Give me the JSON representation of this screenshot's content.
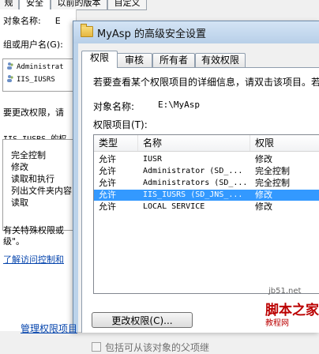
{
  "background": {
    "tabs": [
      "规",
      "安全",
      "以前的版本",
      "自定义"
    ],
    "object_label": "对象名称:",
    "object_value_fragment": "E",
    "group_label": "组或用户名(G):",
    "users": [
      "Administrat",
      "IIS_IUSRS"
    ],
    "change_text": "要更改权限，请",
    "perm_title": "IIS_IUSRS 的权",
    "permissions": [
      "完全控制",
      "修改",
      "读取和执行",
      "列出文件夹内容",
      "读取"
    ],
    "special_text_1": "有关特殊权限或",
    "special_text_2": "级\"。",
    "link_text": "了解访问控制和"
  },
  "dialog": {
    "title": "MyAsp 的高级安全设置",
    "tabs": [
      "权限",
      "审核",
      "所有者",
      "有效权限"
    ],
    "description": "若要查看某个权限项目的详细信息，请双击该项目。若",
    "object_label": "对象名称:",
    "object_value": "E:\\MyAsp",
    "entries_label": "权限项目(T):",
    "columns": [
      "类型",
      "名称",
      "权限"
    ],
    "rows": [
      {
        "type": "允许",
        "name": "IUSR",
        "perm": "修改"
      },
      {
        "type": "允许",
        "name": "Administrator (SD_...",
        "perm": "完全控制"
      },
      {
        "type": "允许",
        "name": "Administrators (SD_...",
        "perm": "完全控制"
      },
      {
        "type": "允许",
        "name": "IIS_IUSRS (SD_JNS_...",
        "perm": "修改"
      },
      {
        "type": "允许",
        "name": "LOCAL SERVICE",
        "perm": "修改"
      }
    ],
    "change_button": "更改权限(C)...",
    "inherit_checkbox": "包括可从该对象的父项继",
    "manage_link": "管理权限项目"
  },
  "watermark": {
    "site": "jb51.net",
    "brand": "脚本之家",
    "sub": "教程网"
  },
  "colors": {
    "selection": "#3399ff",
    "titlebar": "#bcd3ea",
    "link": "#0645ad"
  }
}
